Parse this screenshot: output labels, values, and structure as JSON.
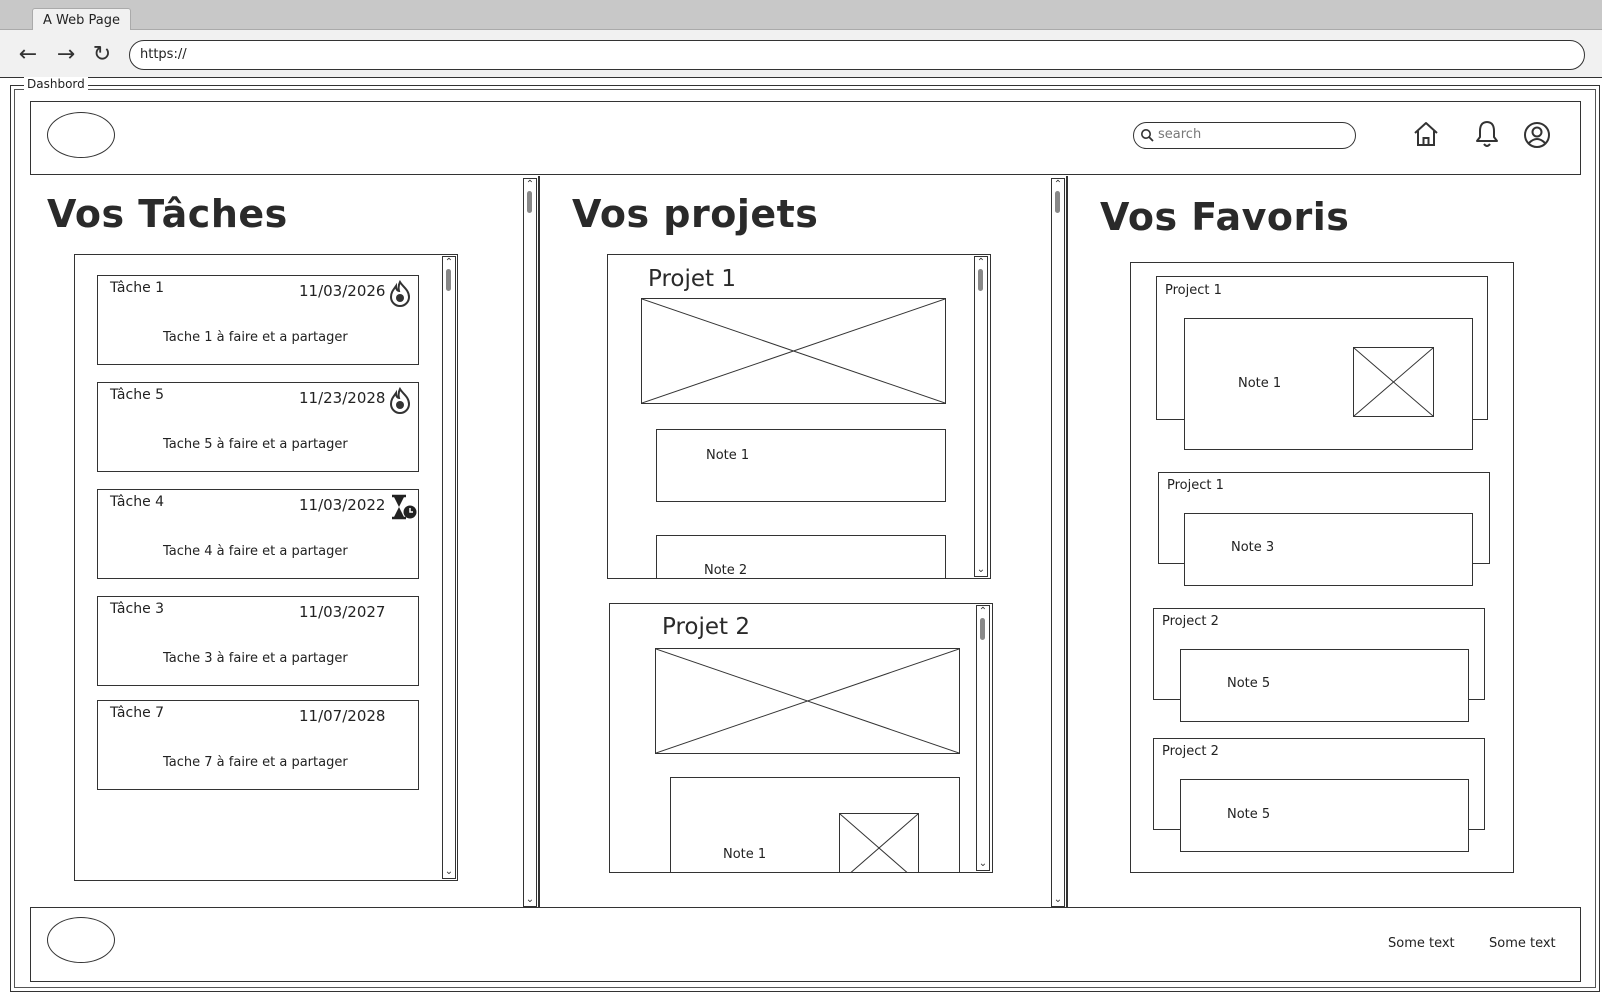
{
  "browser": {
    "tab_title": "A Web Page",
    "url": "https://"
  },
  "window_label": "Dashbord",
  "header": {
    "search_placeholder": "search"
  },
  "tasks": {
    "title": "Vos Tâches",
    "items": [
      {
        "title": "Tâche 1",
        "date": "11/03/2026",
        "desc": "Tache 1 à faire et a partager",
        "icon": "flame-icon"
      },
      {
        "title": "Tâche 5",
        "date": "11/23/2028",
        "desc": "Tache 5 à faire et a partager",
        "icon": "flame-icon"
      },
      {
        "title": "Tâche 4",
        "date": "11/03/2022",
        "desc": "Tache 4 à faire et a partager",
        "icon": "hourglass-clock-icon"
      },
      {
        "title": "Tâche 3",
        "date": "11/03/2027",
        "desc": "Tache 3 à faire et a partager",
        "icon": ""
      },
      {
        "title": "Tâche 7",
        "date": "11/07/2028",
        "desc": "Tache 7 à faire et a partager",
        "icon": ""
      }
    ]
  },
  "projects": {
    "title": "Vos projets",
    "items": [
      {
        "title": "Projet 1",
        "notes": [
          "Note 1",
          "Note 2"
        ]
      },
      {
        "title": "Projet 2",
        "notes": [
          "Note 1"
        ]
      }
    ]
  },
  "favorites": {
    "title": "Vos Favoris",
    "items": [
      {
        "project": "Project 1",
        "note": "Note 1"
      },
      {
        "project": "Project 1",
        "note": "Note 3"
      },
      {
        "project": "Project 2",
        "note": "Note 5"
      },
      {
        "project": "Project 2",
        "note": "Note 5"
      }
    ]
  },
  "footer": {
    "links": [
      "Some text",
      "Some text"
    ]
  }
}
